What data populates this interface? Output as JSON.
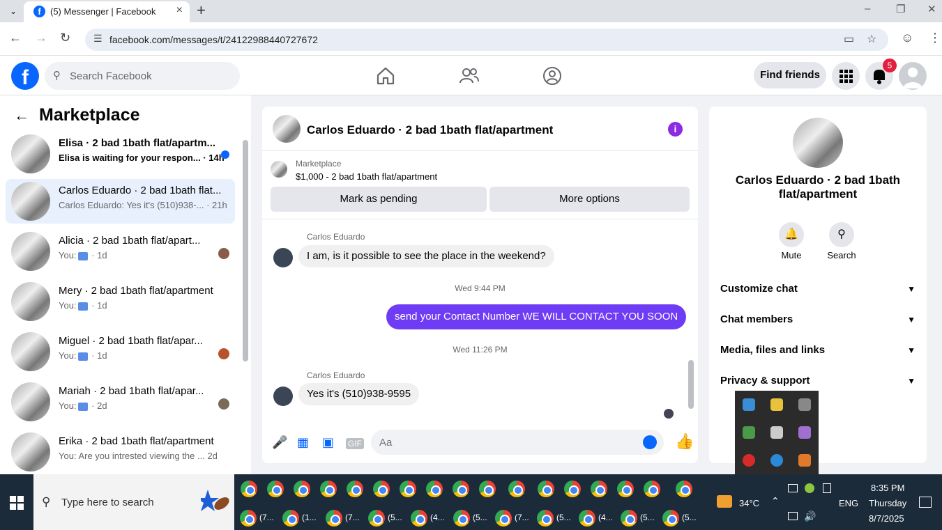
{
  "browser": {
    "tab_title": "(5) Messenger | Facebook",
    "url": "facebook.com/messages/t/24122988440727672"
  },
  "fb_header": {
    "search_placeholder": "Search Facebook",
    "find_friends": "Find friends",
    "notif_count": "5"
  },
  "sidebar": {
    "title": "Marketplace",
    "conversations": [
      {
        "name": "Elisa · 2 bad 1bath flat/apartm...",
        "preview": "Elisa is waiting for your respon...",
        "time": "· 14h",
        "unread": true
      },
      {
        "name": "Carlos Eduardo · 2 bad 1bath flat...",
        "preview": "Carlos Eduardo: Yes it's (510)938-...",
        "time": "· 21h",
        "active": true
      },
      {
        "name": "Alicia · 2 bad 1bath flat/apart...",
        "preview_prefix": "You:",
        "time": "· 1d"
      },
      {
        "name": "Mery · 2 bad 1bath flat/apartment",
        "preview_prefix": "You:",
        "time": "· 1d"
      },
      {
        "name": "Miguel · 2 bad 1bath flat/apar...",
        "preview_prefix": "You:",
        "time": "· 1d"
      },
      {
        "name": "Mariah · 2 bad 1bath flat/apar...",
        "preview_prefix": "You:",
        "time": "· 2d"
      },
      {
        "name": "Erika · 2 bad 1bath flat/apartment",
        "preview": "You: Are you intrested viewing the ...",
        "time": "2d"
      }
    ]
  },
  "chat": {
    "title": "Carlos Eduardo · 2 bad 1bath flat/apartment",
    "marketplace_label": "Marketplace",
    "listing": "$1,000 - 2 bad 1bath flat/apartment",
    "mark_pending": "Mark as pending",
    "more_options": "More options",
    "messages": [
      {
        "sender": "Carlos Eduardo",
        "text": "I am, is it possible to see the place in the weekend?"
      },
      {
        "timestamp": "Wed 9:44 PM"
      },
      {
        "text": "send  your Contact Number  WE WILL CONTACT YOU SOON"
      },
      {
        "timestamp": "Wed 11:26 PM"
      },
      {
        "sender": "Carlos Eduardo",
        "text": "Yes it's (510)938-9595"
      }
    ],
    "composer_placeholder": "Aa",
    "gif_label": "GIF"
  },
  "info_panel": {
    "name": "Carlos Eduardo · 2 bad 1bath flat/apartment",
    "mute": "Mute",
    "search": "Search",
    "sections": [
      "Customize chat",
      "Chat members",
      "Media, files and links",
      "Privacy & support"
    ]
  },
  "taskbar": {
    "search_text": "Type here to search",
    "weather": "34°C",
    "lang": "ENG",
    "time": "8:35 PM",
    "day": "Thursday",
    "date": "8/7/2025",
    "bottom_labels": [
      "(7...",
      "(1...",
      "(7...",
      "(5...",
      "(4...",
      "(5...",
      "(7...",
      "(5...",
      "(4...",
      "(5...",
      "(5..."
    ]
  },
  "colors": {
    "fb_blue": "#0866ff",
    "outgoing_bubble": "#6f3cf5",
    "active_conv": "#e7f0fc",
    "badge_red": "#e41e3f"
  }
}
